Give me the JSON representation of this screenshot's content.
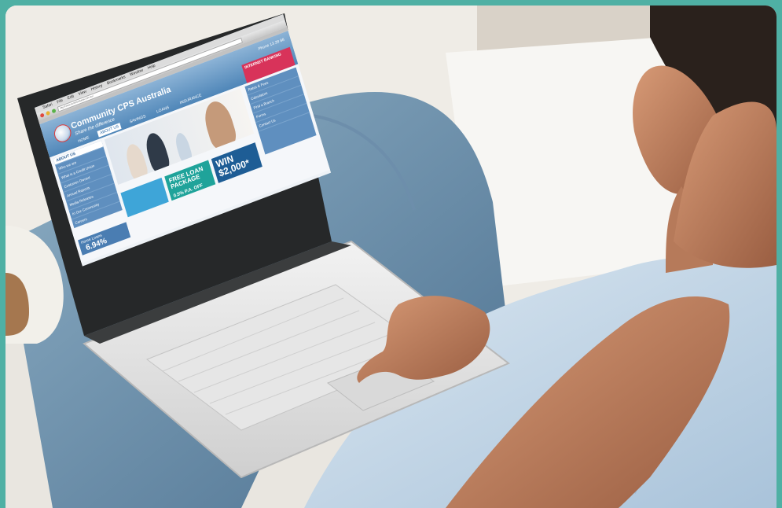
{
  "browser": {
    "menu_items": [
      "Safari",
      "File",
      "Edit",
      "View",
      "History",
      "Bookmarks",
      "Window",
      "Help"
    ],
    "url": "http://www.communitycps.com.au/"
  },
  "website": {
    "brand": "Community CPS Australia",
    "tagline": "Share the difference",
    "phone": "Phone 13 28 88",
    "nav": [
      "HOME",
      "ABOUT US",
      "SAVINGS",
      "LOANS",
      "INSURANCE"
    ],
    "internet_banking": "INTERNET BANKING",
    "sidebar_heading": "ABOUT US",
    "sidebar_items": [
      "Who we are",
      "What is a Credit Union",
      "Customer Owned",
      "Annual Reports",
      "Media Releases",
      "In Our Community",
      "Careers"
    ],
    "right_items": [
      "Rates & Fees",
      "Calculators",
      "Find a Branch",
      "Forms",
      "Contact Us"
    ],
    "promo_loan": "FREE LOAN PACKAGE",
    "promo_rate": "0.5% P.A. OFF",
    "promo_win": "WIN $2,000*",
    "rate_label": "Home Loans",
    "rate_value": "6.94%"
  },
  "colors": {
    "frame": "#4fb0a4",
    "site_blue": "#4f86b8",
    "site_pink": "#d8335a",
    "promo_teal": "#1fa39a"
  }
}
